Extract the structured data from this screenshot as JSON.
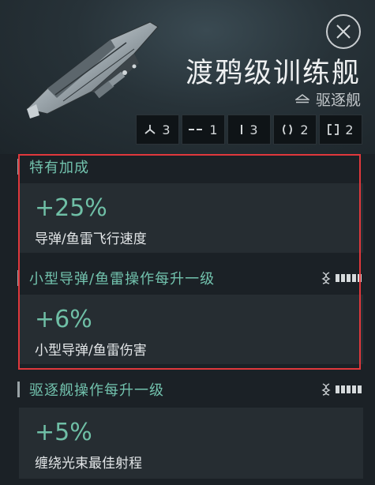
{
  "header": {
    "title": "渡鸦级训练舰",
    "ship_class": "驱逐舰"
  },
  "slots": [
    {
      "icon": "high-slot-icon",
      "count": "3"
    },
    {
      "icon": "medium-slot-icon",
      "count": "1"
    },
    {
      "icon": "low-slot-icon",
      "count": "3"
    },
    {
      "icon": "rig-slot-icon",
      "count": "2"
    },
    {
      "icon": "subsystem-slot-icon",
      "count": "2"
    }
  ],
  "sections": [
    {
      "title": "特有加成",
      "value": "+25%",
      "desc": "导弹/鱼雷飞行速度",
      "skill_level": 0
    },
    {
      "title": "小型导弹/鱼雷操作每升一级",
      "value": "+6%",
      "desc": "小型导弹/鱼雷伤害",
      "skill_level": 5
    },
    {
      "title": "驱逐舰操作每升一级",
      "value": "+5%",
      "desc": "缠绕光束最佳射程",
      "skill_level": 5
    }
  ],
  "colors": {
    "accent_teal": "#6fbfa6",
    "highlight_red": "#e0383c"
  }
}
